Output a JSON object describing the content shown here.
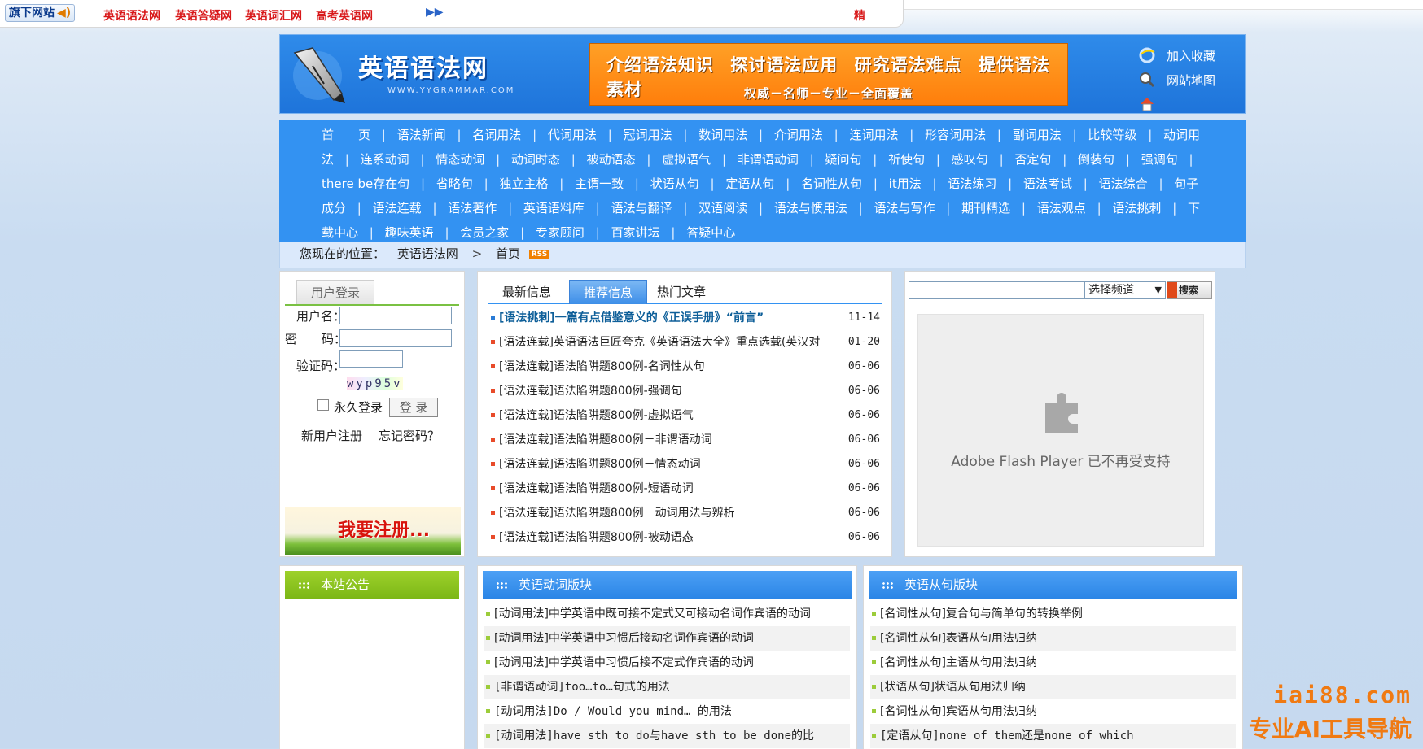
{
  "topbar": {
    "site_label": "旗下网站",
    "links": [
      "英语语法网",
      "英语答疑网",
      "英语词汇网",
      "高考英语网"
    ],
    "jing": "精"
  },
  "header": {
    "logo_title": "英语语法网",
    "logo_url": "WWW.YYGRAMMAR.COM",
    "banner_line1": "介绍语法知识 探讨语法应用 研究语法难点 提供语法素材",
    "banner_line2": "权威－名师－专业－全面覆盖",
    "links": [
      "加入收藏",
      "网站地图"
    ]
  },
  "nav": {
    "items": [
      "首　　页",
      "语法新闻",
      "名词用法",
      "代词用法",
      "冠词用法",
      "数词用法",
      "介词用法",
      "连词用法",
      "形容词用法",
      "副词用法",
      "比较等级",
      "动词用法",
      "连系动词",
      "情态动词",
      "动词时态",
      "被动语态",
      "虚拟语气",
      "非谓语动词",
      "疑问句",
      "祈使句",
      "感叹句",
      "否定句",
      "倒装句",
      "强调句",
      "there be存在句",
      "省略句",
      "独立主格",
      "主谓一致",
      "状语从句",
      "定语从句",
      "名词性从句",
      "it用法",
      "语法练习",
      "语法考试",
      "语法综合",
      "句子成分",
      "语法连载",
      "语法著作",
      "英语语料库",
      "语法与翻译",
      "双语阅读",
      "语法与惯用法",
      "语法与写作",
      "期刊精选",
      "语法观点",
      "语法挑刺",
      "下载中心",
      "趣味英语",
      "会员之家",
      "专家顾问",
      "百家讲坛",
      "答疑中心"
    ]
  },
  "breadcrumb": {
    "prefix": "您现在的位置：",
    "site": "英语语法网",
    "sep": ">",
    "page": "首页",
    "rss": "RSS"
  },
  "login": {
    "tab": "用户登录",
    "username_label": "用户名：",
    "password_label": "密　　码：",
    "captcha_label": "验证码：",
    "captcha_text": "wyp95v",
    "remember_label": "永久登录",
    "login_button": "登 录",
    "register_link": "新用户注册",
    "forgot_link": "忘记密码？",
    "register_banner": "我要注册..."
  },
  "news": {
    "tabs": [
      "最新信息",
      "推荐信息",
      "热门文章"
    ],
    "active_tab": 1,
    "items": [
      {
        "title": "[语法挑刺]一篇有点借鉴意义的《正误手册》“前言”",
        "date": "11-14"
      },
      {
        "title": "[语法连载]英语语法巨匠夸克《英语语法大全》重点选载(英汉对",
        "date": "01-20"
      },
      {
        "title": "[语法连载]语法陷阱题800例-名词性从句",
        "date": "06-06"
      },
      {
        "title": "[语法连载]语法陷阱题800例-强调句",
        "date": "06-06"
      },
      {
        "title": "[语法连载]语法陷阱题800例-虚拟语气",
        "date": "06-06"
      },
      {
        "title": "[语法连载]语法陷阱题800例－非谓语动词",
        "date": "06-06"
      },
      {
        "title": "[语法连载]语法陷阱题800例－情态动词",
        "date": "06-06"
      },
      {
        "title": "[语法连载]语法陷阱题800例-短语动词",
        "date": "06-06"
      },
      {
        "title": "[语法连载]语法陷阱题800例－动词用法与辨析",
        "date": "06-06"
      },
      {
        "title": "[语法连载]语法陷阱题800例-被动语态",
        "date": "06-06"
      }
    ]
  },
  "search": {
    "select_value": "选择频道",
    "button": "搜索"
  },
  "flash": {
    "message": "Adobe Flash Player 已不再受支持"
  },
  "notice": {
    "title": "本站公告"
  },
  "verb": {
    "title": "英语动词版块",
    "items": [
      "[动词用法]中学英语中既可接不定式又可接动名词作宾语的动词",
      "[动词用法]中学英语中习惯后接动名词作宾语的动词",
      "[动词用法]中学英语中习惯后接不定式作宾语的动词",
      "[非谓语动词]too…to…句式的用法",
      "[动词用法]Do / Would you mind… 的用法",
      "[动词用法]have sth to do与have sth to be done的比"
    ]
  },
  "clause": {
    "title": "英语从句版块",
    "items": [
      "[名词性从句]复合句与简单句的转换举例",
      "[名词性从句]表语从句用法归纳",
      "[名词性从句]主语从句用法归纳",
      "[状语从句]状语从句用法归纳",
      "[名词性从句]宾语从句用法归纳",
      "[定语从句]none of them还是none of which"
    ]
  },
  "watermark": {
    "line1": "iai88.com",
    "line2": "专业AI工具导航"
  },
  "colors": {
    "nav_blue": "#3392f2",
    "banner_orange": "#ff8a16",
    "red_link": "#d8181a",
    "green_accent": "#7cb716"
  }
}
